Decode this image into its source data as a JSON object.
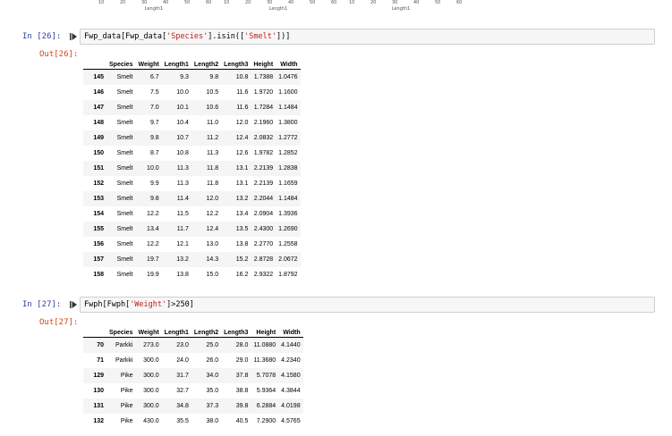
{
  "plot_strip": {
    "panels": [
      {
        "ticks": [
          "10",
          "20",
          "30",
          "40",
          "50",
          "60"
        ],
        "xlabel": "Length1"
      },
      {
        "ticks": [
          "10",
          "20",
          "30",
          "40",
          "50",
          "60"
        ],
        "xlabel": "Length1"
      },
      {
        "ticks": [
          "10",
          "20",
          "30",
          "40",
          "50",
          "60"
        ],
        "xlabel": "Length1"
      }
    ]
  },
  "cells": [
    {
      "in_prompt": "In [26]:",
      "out_prompt": "Out[26]:",
      "code_pre": "Fwp_data[Fwp_data[",
      "code_str1": "'Species'",
      "code_mid": "].isin([",
      "code_str2": "'Smelt'",
      "code_post": "])]",
      "columns": [
        "Species",
        "Weight",
        "Length1",
        "Length2",
        "Length3",
        "Height",
        "Width"
      ],
      "rows": [
        {
          "idx": "145",
          "vals": [
            "Smelt",
            "6.7",
            "9.3",
            "9.8",
            "10.8",
            "1.7388",
            "1.0476"
          ]
        },
        {
          "idx": "146",
          "vals": [
            "Smelt",
            "7.5",
            "10.0",
            "10.5",
            "11.6",
            "1.9720",
            "1.1600"
          ]
        },
        {
          "idx": "147",
          "vals": [
            "Smelt",
            "7.0",
            "10.1",
            "10.6",
            "11.6",
            "1.7284",
            "1.1484"
          ]
        },
        {
          "idx": "148",
          "vals": [
            "Smelt",
            "9.7",
            "10.4",
            "11.0",
            "12.0",
            "2.1960",
            "1.3800"
          ]
        },
        {
          "idx": "149",
          "vals": [
            "Smelt",
            "9.8",
            "10.7",
            "11.2",
            "12.4",
            "2.0832",
            "1.2772"
          ]
        },
        {
          "idx": "150",
          "vals": [
            "Smelt",
            "8.7",
            "10.8",
            "11.3",
            "12.6",
            "1.9782",
            "1.2852"
          ]
        },
        {
          "idx": "151",
          "vals": [
            "Smelt",
            "10.0",
            "11.3",
            "11.8",
            "13.1",
            "2.2139",
            "1.2838"
          ]
        },
        {
          "idx": "152",
          "vals": [
            "Smelt",
            "9.9",
            "11.3",
            "11.8",
            "13.1",
            "2.2139",
            "1.1659"
          ]
        },
        {
          "idx": "153",
          "vals": [
            "Smelt",
            "9.8",
            "11.4",
            "12.0",
            "13.2",
            "2.2044",
            "1.1484"
          ]
        },
        {
          "idx": "154",
          "vals": [
            "Smelt",
            "12.2",
            "11.5",
            "12.2",
            "13.4",
            "2.0904",
            "1.3936"
          ]
        },
        {
          "idx": "155",
          "vals": [
            "Smelt",
            "13.4",
            "11.7",
            "12.4",
            "13.5",
            "2.4300",
            "1.2690"
          ]
        },
        {
          "idx": "156",
          "vals": [
            "Smelt",
            "12.2",
            "12.1",
            "13.0",
            "13.8",
            "2.2770",
            "1.2558"
          ]
        },
        {
          "idx": "157",
          "vals": [
            "Smelt",
            "19.7",
            "13.2",
            "14.3",
            "15.2",
            "2.8728",
            "2.0672"
          ]
        },
        {
          "idx": "158",
          "vals": [
            "Smelt",
            "19.9",
            "13.8",
            "15.0",
            "16.2",
            "2.9322",
            "1.8792"
          ]
        }
      ]
    },
    {
      "in_prompt": "In [27]:",
      "out_prompt": "Out[27]:",
      "code_pre": "Fwph[Fwph[",
      "code_str1": "'Weight'",
      "code_mid": "]>250]",
      "code_str2": "",
      "code_post": "",
      "columns": [
        "Species",
        "Weight",
        "Length1",
        "Length2",
        "Length3",
        "Height",
        "Width"
      ],
      "rows": [
        {
          "idx": "70",
          "vals": [
            "Parkki",
            "273.0",
            "23.0",
            "25.0",
            "28.0",
            "11.0880",
            "4.1440"
          ]
        },
        {
          "idx": "71",
          "vals": [
            "Parkki",
            "300.0",
            "24.0",
            "26.0",
            "29.0",
            "11.3680",
            "4.2340"
          ]
        },
        {
          "idx": "129",
          "vals": [
            "Pike",
            "300.0",
            "31.7",
            "34.0",
            "37.8",
            "5.7078",
            "4.1580"
          ]
        },
        {
          "idx": "130",
          "vals": [
            "Pike",
            "300.0",
            "32.7",
            "35.0",
            "38.8",
            "5.9364",
            "4.3844"
          ]
        },
        {
          "idx": "131",
          "vals": [
            "Pike",
            "300.0",
            "34.8",
            "37.3",
            "39.8",
            "6.2884",
            "4.0198"
          ]
        },
        {
          "idx": "132",
          "vals": [
            "Pike",
            "430.0",
            "35.5",
            "38.0",
            "40.5",
            "7.2900",
            "4.5765"
          ]
        }
      ]
    }
  ]
}
